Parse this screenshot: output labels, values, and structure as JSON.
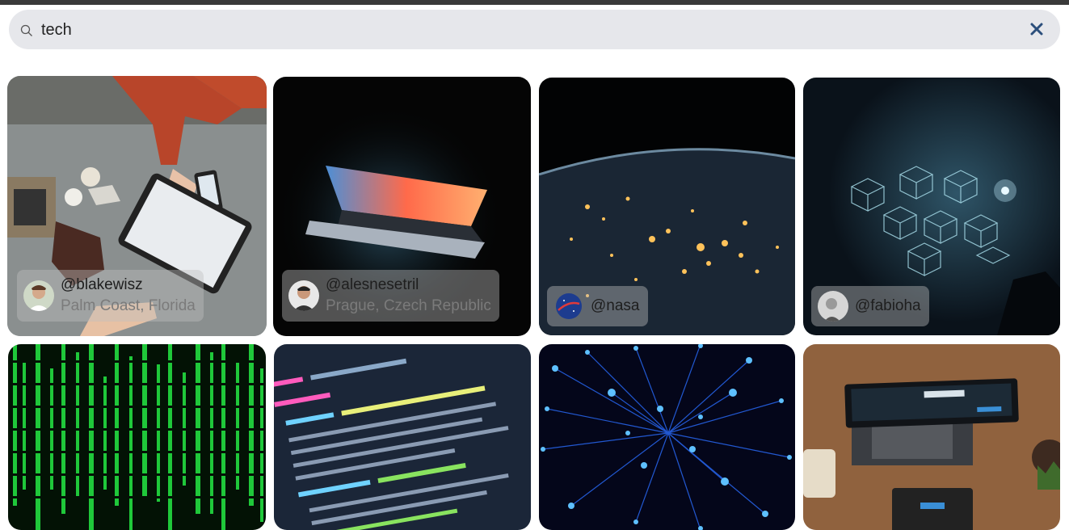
{
  "search": {
    "value": "tech",
    "icon": "search-icon",
    "clear_icon": "close-icon"
  },
  "colors": {
    "search_bg": "#e6e7eb",
    "clear_icon": "#2c4f7c",
    "top_bar": "#3a3a3a"
  },
  "photos": [
    {
      "handle": "@blakewisz",
      "location": "Palm Coast, Florida",
      "subject": "hands-tablet-desk"
    },
    {
      "handle": "@alesnesetril",
      "location": "Prague, Czech Republic",
      "subject": "laptop-dark"
    },
    {
      "handle": "@nasa",
      "location": "",
      "subject": "earth-night-lights"
    },
    {
      "handle": "@fabioha",
      "location": "",
      "subject": "glowing-cubes"
    },
    {
      "handle": "",
      "location": "",
      "subject": "green-matrix-code"
    },
    {
      "handle": "",
      "location": "",
      "subject": "code-screen"
    },
    {
      "handle": "",
      "location": "",
      "subject": "blue-fiber-optics"
    },
    {
      "handle": "",
      "location": "",
      "subject": "payment-terminal"
    }
  ]
}
